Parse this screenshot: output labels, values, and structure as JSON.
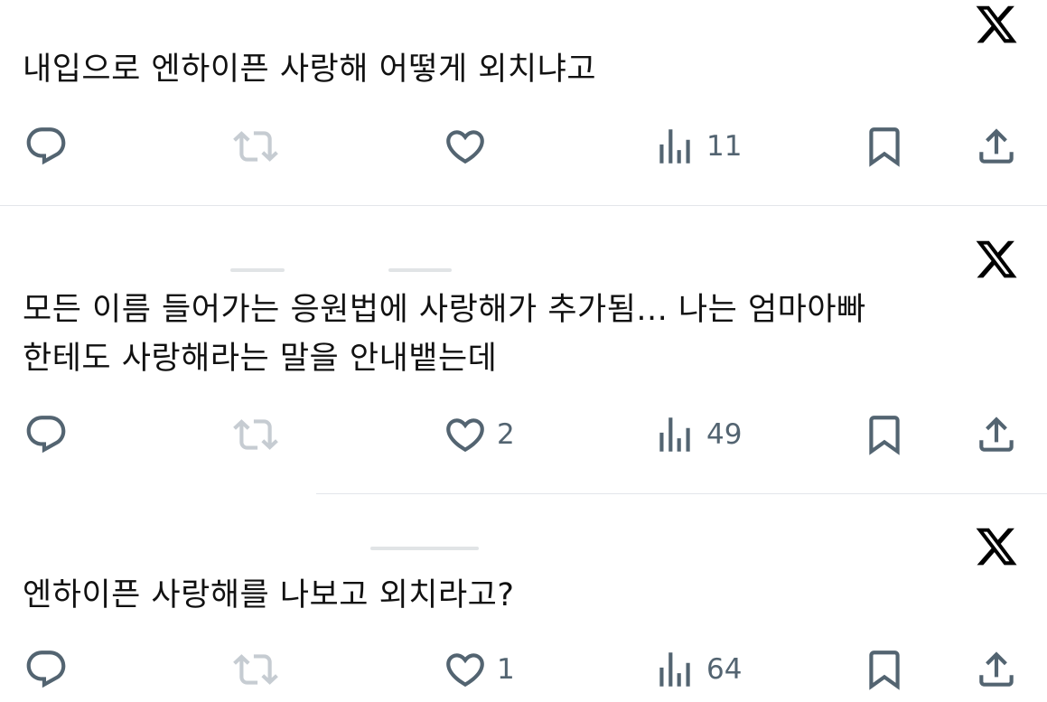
{
  "brand_logo": "x-logo-icon",
  "colors": {
    "icon": "#536471",
    "icon_disabled": "#c6ccd2",
    "text": "#0f1419",
    "divider": "#e3e6ea"
  },
  "tweets": [
    {
      "lines": [
        "내입으로 엔하이픈 사랑해 어떻게 외치냐고"
      ],
      "likes": "",
      "views": "11"
    },
    {
      "lines": [
        "모든 이름 들어가는 응원법에 사랑해가 추가됨... 나는 엄마아빠",
        "한테도 사랑해라는 말을 안내뱉는데"
      ],
      "likes": "2",
      "views": "49"
    },
    {
      "lines": [
        "엔하이픈 사랑해를 나보고 외치라고?"
      ],
      "likes": "1",
      "views": "64"
    }
  ]
}
